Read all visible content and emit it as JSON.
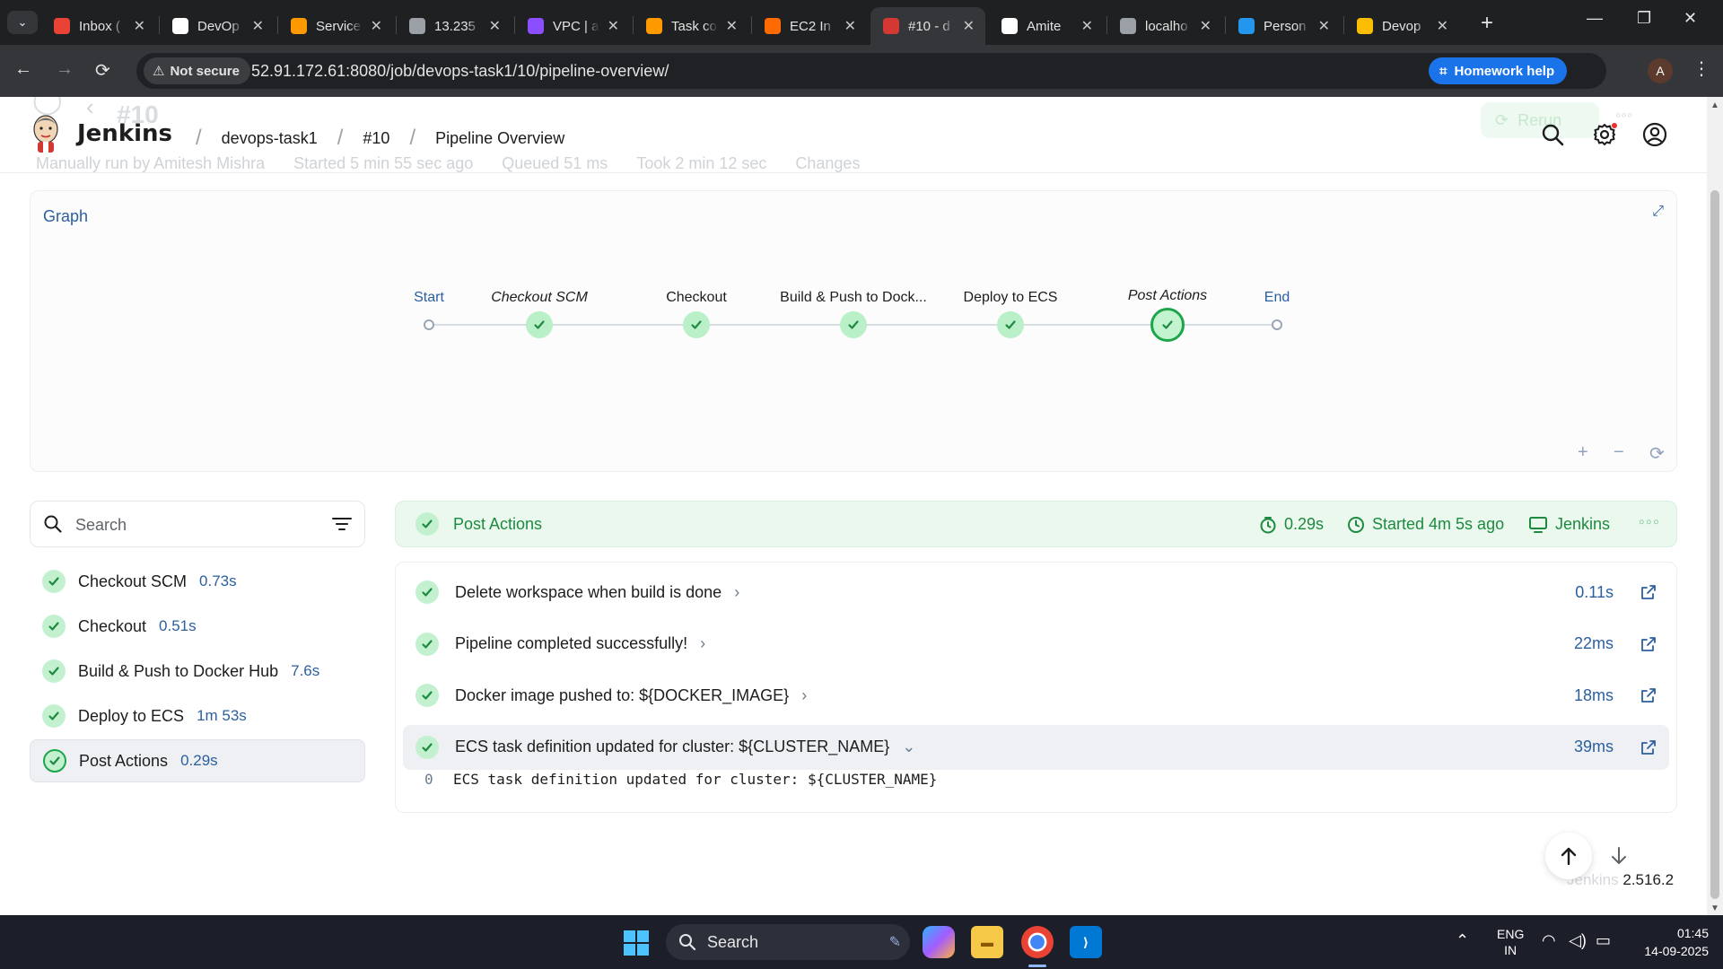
{
  "browser": {
    "tabs": [
      {
        "title": "Inbox (",
        "favicon": "gmail-icon",
        "color": "#ea4335",
        "active": false
      },
      {
        "title": "DevOp",
        "favicon": "notion-icon",
        "color": "#ffffff",
        "active": false
      },
      {
        "title": "Service",
        "favicon": "aws-service-icon",
        "color": "#ff9900",
        "active": false
      },
      {
        "title": "13.235",
        "favicon": "globe-icon",
        "color": "#9aa0a6",
        "active": false
      },
      {
        "title": "VPC | a",
        "favicon": "vpc-icon",
        "color": "#8c4fff",
        "active": false
      },
      {
        "title": "Task co",
        "favicon": "aws-service-icon",
        "color": "#ff9900",
        "active": false
      },
      {
        "title": "EC2 In",
        "favicon": "ec2-icon",
        "color": "#ff6b00",
        "active": false
      },
      {
        "title": "#10 - d",
        "favicon": "jenkins-icon",
        "color": "#d33833",
        "active": true
      },
      {
        "title": "Amite",
        "favicon": "github-icon",
        "color": "#ffffff",
        "active": false
      },
      {
        "title": "localho",
        "favicon": "globe-icon",
        "color": "#9aa0a6",
        "active": false
      },
      {
        "title": "Person",
        "favicon": "docker-icon",
        "color": "#2496ed",
        "active": false
      },
      {
        "title": "Devop",
        "favicon": "drive-icon",
        "color": "#fbbc04",
        "active": false
      }
    ],
    "security_label": "Not secure",
    "url": "52.91.172.61:8080/job/devops-task1/10/pipeline-overview/",
    "homework_help": "Homework help",
    "profile_initial": "A"
  },
  "jenkins": {
    "brand": "Jenkins",
    "breadcrumbs": [
      "devops-task1",
      "#10",
      "Pipeline Overview"
    ],
    "ghost": {
      "build_title": "#10",
      "rerun": "Rerun",
      "run_by": "Manually run by Amitesh Mishra",
      "started": "Started 5 min 55 sec ago",
      "queued": "Queued 51 ms",
      "took": "Took 2 min 12 sec",
      "changes": "Changes"
    },
    "graph": {
      "label": "Graph",
      "stages": [
        {
          "name": "Start",
          "kind": "endpoint"
        },
        {
          "name": "Checkout SCM",
          "kind": "ok",
          "italic": true
        },
        {
          "name": "Checkout",
          "kind": "ok"
        },
        {
          "name": "Build & Push to Dock...",
          "kind": "ok"
        },
        {
          "name": "Deploy to ECS",
          "kind": "ok"
        },
        {
          "name": "Post Actions",
          "kind": "ok-selected",
          "italic": true
        },
        {
          "name": "End",
          "kind": "endpoint"
        }
      ],
      "zoom_in": "+",
      "zoom_out": "−",
      "reset": "⟳"
    },
    "sidebar": {
      "search_placeholder": "Search",
      "stages": [
        {
          "name": "Checkout SCM",
          "duration": "0.73s",
          "selected": false
        },
        {
          "name": "Checkout",
          "duration": "0.51s",
          "selected": false
        },
        {
          "name": "Build & Push to Docker Hub",
          "duration": "7.6s",
          "selected": false
        },
        {
          "name": "Deploy to ECS",
          "duration": "1m 53s",
          "selected": false
        },
        {
          "name": "Post Actions",
          "duration": "0.29s",
          "selected": true
        }
      ]
    },
    "detail": {
      "title": "Post Actions",
      "duration": "0.29s",
      "started": "Started 4m 5s ago",
      "agent": "Jenkins",
      "steps": [
        {
          "text": "Delete workspace when build is done",
          "duration": "0.11s",
          "expanded": false
        },
        {
          "text": "Pipeline completed successfully!",
          "duration": "22ms",
          "expanded": false
        },
        {
          "text": "Docker image pushed to: ${DOCKER_IMAGE}",
          "duration": "18ms",
          "expanded": false
        },
        {
          "text": "ECS task definition updated for cluster: ${CLUSTER_NAME}",
          "duration": "39ms",
          "expanded": true
        }
      ],
      "log": {
        "line_number": "0",
        "text": "ECS task definition updated for cluster: ${CLUSTER_NAME}"
      }
    },
    "footer": {
      "version_faded": "Jenkins ",
      "version": "2.516.2"
    }
  },
  "taskbar": {
    "search_label": "Search",
    "language": "ENG",
    "region": "IN",
    "time": "01:45",
    "date": "14-09-2025"
  },
  "colors": {
    "success_green": "#1ea54a",
    "accent_blue": "#2b5f9e",
    "chrome_dark": "#35363a"
  }
}
